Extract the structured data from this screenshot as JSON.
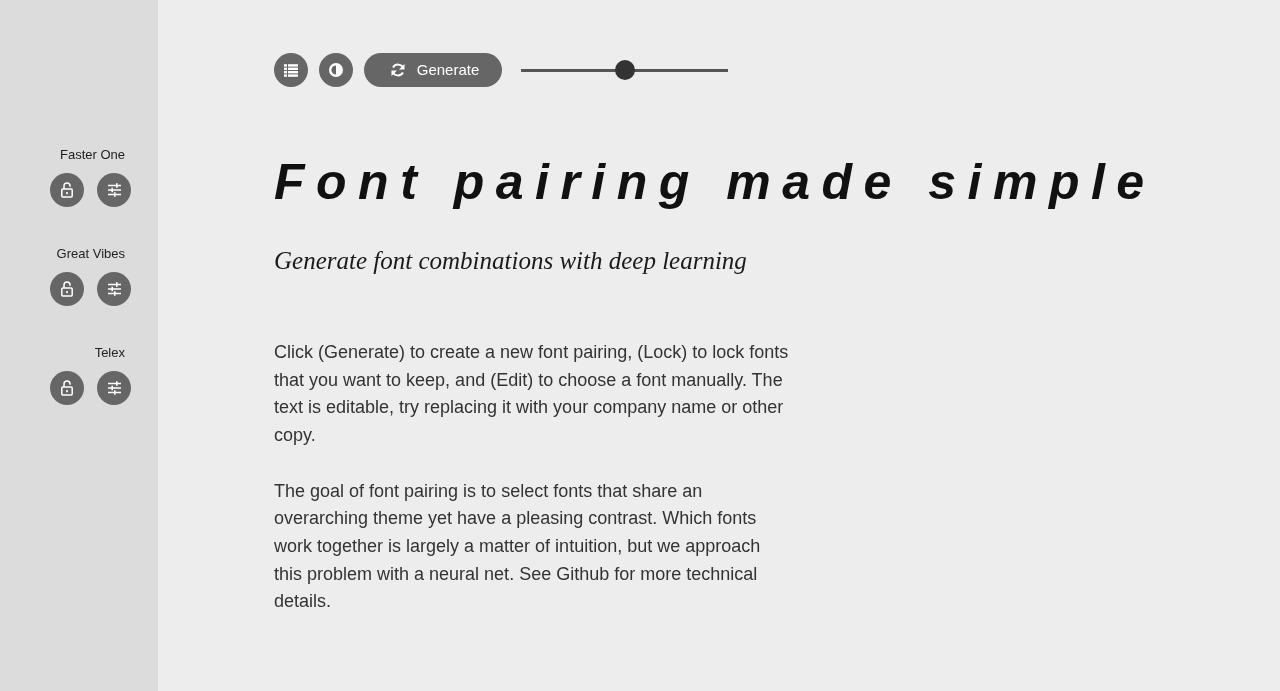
{
  "toolbar": {
    "generate_label": "Generate",
    "slider": {
      "level": 0.5
    }
  },
  "sidebar": {
    "fonts": [
      {
        "name": "Faster One",
        "locked": false
      },
      {
        "name": "Great Vibes",
        "locked": false
      },
      {
        "name": "Telex",
        "locked": false
      }
    ]
  },
  "heading": "Font pairing made simple",
  "subheading": "Generate font combinations with deep learning",
  "paragraphs": [
    "Click (Generate) to create a new font pairing, (Lock) to lock fonts that you want to keep, and (Edit) to choose a font manually. The text is editable, try replacing it with your company name or other copy.",
    "The goal of font pairing is to select fonts that share an overarching theme yet have a pleasing contrast. Which fonts work together is largely a matter of intuition, but we approach this problem with a neural net. See Github for more technical details."
  ]
}
